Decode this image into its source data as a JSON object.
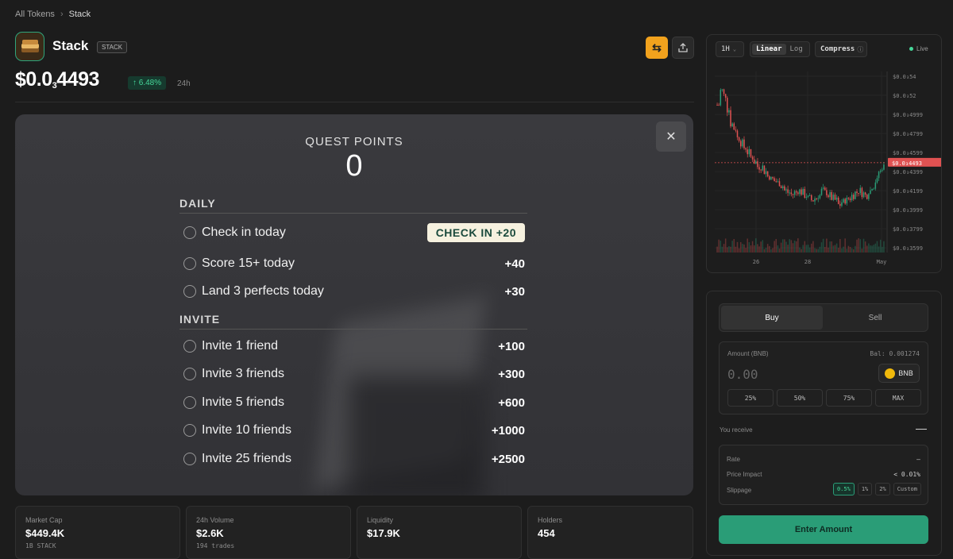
{
  "breadcrumb": {
    "root": "All Tokens",
    "sep": "›",
    "current": "Stack"
  },
  "token": {
    "name": "Stack",
    "symbol": "STACK",
    "price_main": "$0.0",
    "price_sub": "3",
    "price_tail": "4493",
    "change": "↑ 6.48%",
    "period": "24h"
  },
  "icons": {
    "swap": "⇆",
    "share": "share-icon",
    "close": "✕"
  },
  "quest": {
    "title": "QUEST POINTS",
    "points": "0",
    "daily_label": "DAILY",
    "daily": [
      {
        "label": "Check in today",
        "action": "CHECK IN +20"
      },
      {
        "label": "Score 15+ today",
        "points": "+40"
      },
      {
        "label": "Land 3 perfects today",
        "points": "+30"
      }
    ],
    "invite_label": "INVITE",
    "invite": [
      {
        "label": "Invite 1 friend",
        "points": "+100"
      },
      {
        "label": "Invite 3 friends",
        "points": "+300"
      },
      {
        "label": "Invite 5 friends",
        "points": "+600"
      },
      {
        "label": "Invite 10 friends",
        "points": "+1000"
      },
      {
        "label": "Invite 25 friends",
        "points": "+2500"
      }
    ]
  },
  "stats": [
    {
      "label": "Market Cap",
      "value": "$449.4K",
      "sub": "1B STACK"
    },
    {
      "label": "24h Volume",
      "value": "$2.6K",
      "sub": "194 trades"
    },
    {
      "label": "Liquidity",
      "value": "$17.9K",
      "sub": ""
    },
    {
      "label": "Holders",
      "value": "454",
      "sub": ""
    }
  ],
  "chart": {
    "interval": "1H",
    "scale_linear": "Linear",
    "scale_log": "Log",
    "compress": "Compress",
    "live": "Live",
    "current_label": "$0.0₃4493"
  },
  "chart_data": {
    "type": "candlestick",
    "y_ticks": [
      "$0.0₃54",
      "$0.0₃52",
      "$0.0₃4999",
      "$0.0₃4799",
      "$0.0₃4599",
      "$0.0₃4399",
      "$0.0₃4199",
      "$0.0₃3999",
      "$0.0₃3799",
      "$0.0₃3599"
    ],
    "x_ticks": [
      "26",
      "28",
      "May"
    ],
    "current": 0.4493,
    "close_path": [
      0.51,
      0.525,
      0.52,
      0.505,
      0.49,
      0.485,
      0.475,
      0.47,
      0.465,
      0.46,
      0.455,
      0.45,
      0.445,
      0.445,
      0.44,
      0.435,
      0.432,
      0.43,
      0.428,
      0.425,
      0.42,
      0.418,
      0.416,
      0.418,
      0.42,
      0.418,
      0.415,
      0.412,
      0.41,
      0.412,
      0.415,
      0.42,
      0.418,
      0.415,
      0.412,
      0.41,
      0.405,
      0.408,
      0.41,
      0.412,
      0.415,
      0.418,
      0.42,
      0.417,
      0.415,
      0.42,
      0.425,
      0.43,
      0.44,
      0.445
    ],
    "y_range": [
      0.355,
      0.545
    ]
  },
  "trade": {
    "tab_buy": "Buy",
    "tab_sell": "Sell",
    "amount_label": "Amount (BNB)",
    "balance": "Bal: 0.001274",
    "amount_placeholder": "0.00",
    "currency": "BNB",
    "presets": [
      "25%",
      "50%",
      "75%",
      "MAX"
    ],
    "receive_label": "You receive",
    "receive_value": "—",
    "rate_label": "Rate",
    "rate_value": "–",
    "impact_label": "Price Impact",
    "impact_value": "< 0.01%",
    "slippage_label": "Slippage",
    "slippage_opts": [
      "0.5%",
      "1%",
      "2%",
      "Custom"
    ],
    "submit": "Enter Amount"
  },
  "colors": {
    "accent": "#f2a21d",
    "green": "#2a9d77",
    "up": "#46d89a",
    "down": "#e05252"
  }
}
